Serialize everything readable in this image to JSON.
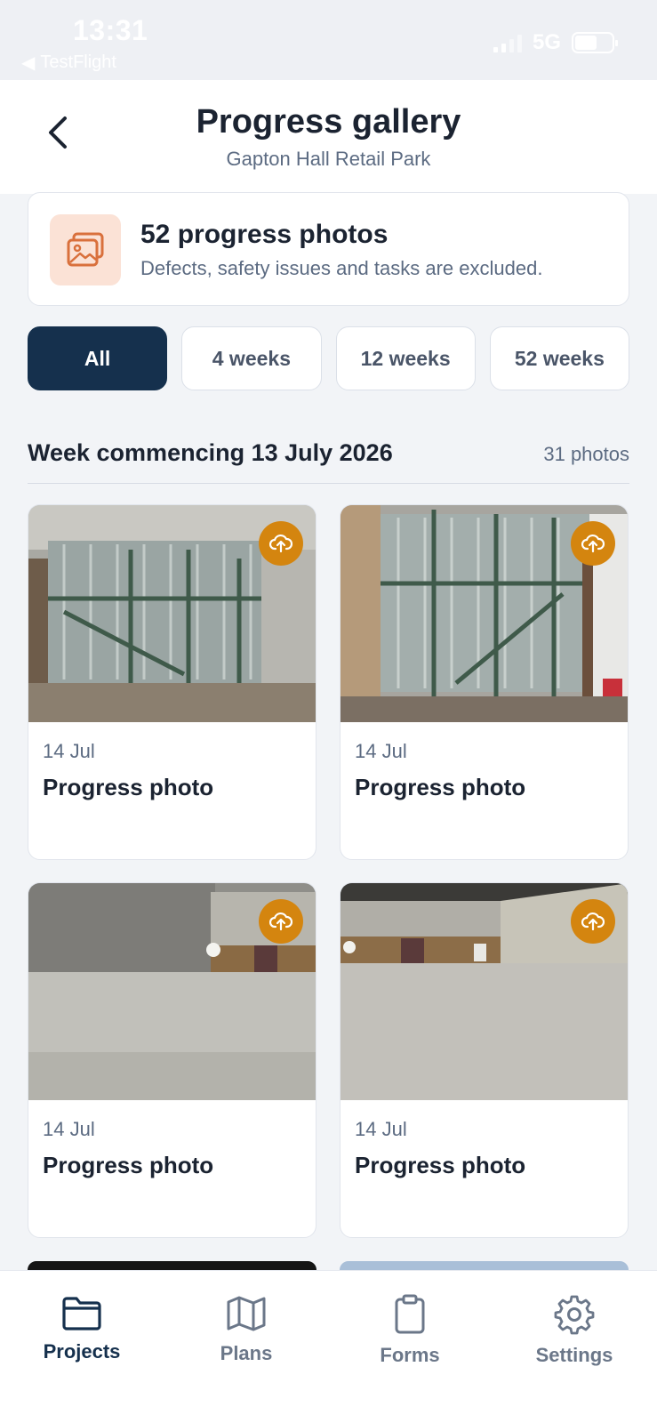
{
  "status_bar": {
    "time": "13:31",
    "back_app": "TestFlight",
    "network": "5G"
  },
  "header": {
    "title": "Progress gallery",
    "subtitle": "Gapton Hall Retail Park"
  },
  "summary": {
    "title": "52 progress photos",
    "subtitle": "Defects, safety issues and tasks are excluded.",
    "icon": "image-gallery-icon",
    "icon_color": "#d9703c",
    "icon_bg": "#fbe2d6"
  },
  "filters": [
    {
      "label": "All",
      "active": true
    },
    {
      "label": "4 weeks",
      "active": false
    },
    {
      "label": "12 weeks",
      "active": false
    },
    {
      "label": "52 weeks",
      "active": false
    }
  ],
  "section": {
    "title": "Week commencing 13 July 2026",
    "count": "31 photos"
  },
  "photos": [
    {
      "date": "14 Jul",
      "title": "Progress photo",
      "status_icon": "cloud-upload-icon"
    },
    {
      "date": "14 Jul",
      "title": "Progress photo",
      "status_icon": "cloud-upload-icon"
    },
    {
      "date": "14 Jul",
      "title": "Progress photo",
      "status_icon": "cloud-upload-icon"
    },
    {
      "date": "14 Jul",
      "title": "Progress photo",
      "status_icon": "cloud-upload-icon"
    }
  ],
  "tabs": [
    {
      "label": "Projects",
      "icon": "folder-icon",
      "active": true
    },
    {
      "label": "Plans",
      "icon": "map-icon",
      "active": false
    },
    {
      "label": "Forms",
      "icon": "clipboard-icon",
      "active": false
    },
    {
      "label": "Settings",
      "icon": "gear-icon",
      "active": false
    }
  ],
  "colors": {
    "primary": "#15304d",
    "accent": "#d4850f",
    "text": "#1b2331",
    "muted": "#5c6b82",
    "background": "#f2f4f7"
  }
}
